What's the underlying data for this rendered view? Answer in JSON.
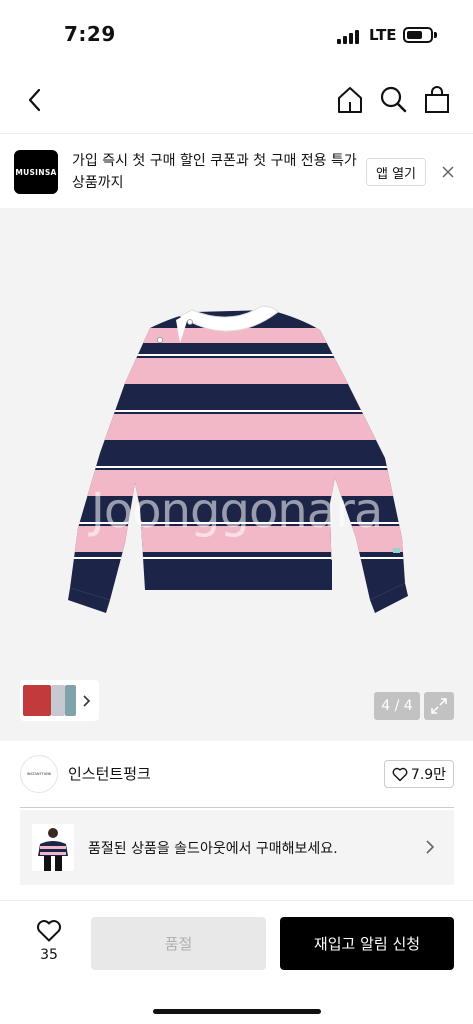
{
  "status_bar": {
    "time": "7:29",
    "network": "LTE",
    "battery_level": 0.7
  },
  "nav": {
    "icons": [
      "back-icon",
      "home-icon",
      "search-icon",
      "shopping-bag-icon"
    ]
  },
  "app_banner": {
    "logo_text": "MUSINSA",
    "message": "가입 즉시 첫 구매 할인 쿠폰과 첫 구매 전용 특가 상품까지",
    "open_app_label": "앱 열기",
    "close_icon": "close-icon"
  },
  "product_image": {
    "watermark": "Joonggonara",
    "image_counter": "4 / 4",
    "expand_icon": "expand-icon",
    "colors": {
      "pink": "#f2b8c8",
      "navy": "#1c2448",
      "background": "#f3f3f3"
    }
  },
  "brand": {
    "logo_text": "INSTANTFUNK",
    "name": "인스턴트펑크",
    "like_count": "7.9만"
  },
  "soldout_notice": {
    "text": "품절된 상품을 솔드아웃에서 구매해보세요."
  },
  "bottom_bar": {
    "wish_count": "35",
    "soldout_label": "품절",
    "restock_label": "재입고 알림 신청"
  }
}
